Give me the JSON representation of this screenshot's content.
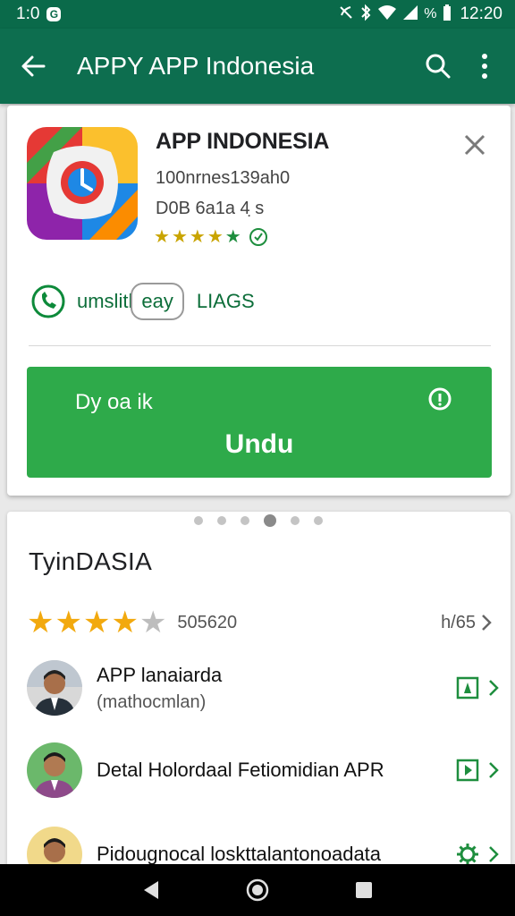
{
  "status_bar": {
    "time_left": "1:0",
    "time_right": "12:20",
    "icons": [
      "notification-badge",
      "mute-icon",
      "bluetooth-icon",
      "wifi-icon",
      "signal-icon",
      "battery-icon"
    ],
    "percent_glyph": "%"
  },
  "app_bar": {
    "title": "APPY APP Indonesia",
    "back_icon": "arrow-left-icon",
    "search_icon": "search-icon",
    "menu_icon": "more-vert-icon"
  },
  "app_card": {
    "name": "APP INDONESIA",
    "meta1": "100nrnes139ah0",
    "meta2": "D0B 6a1a 4 ̣s",
    "stars": 5,
    "feature_text1": "umslitl",
    "feature_pill": "eay",
    "feature_text2": "LIAGS",
    "install_sub": "Dy oa ik",
    "install_label": "Undu"
  },
  "pager": {
    "count": 6,
    "active": 3
  },
  "reviews_section": {
    "title": "TyinDASIA",
    "rating_stars_filled": 4,
    "rating_count": "505620",
    "rating_right": "h/65",
    "items": [
      {
        "title": "APP lanaiarda",
        "subtitle": "(mathocmlan)"
      },
      {
        "title": "Detal Holordaal Fetiomidian APR",
        "subtitle": ""
      },
      {
        "title": "Pidougnocal loskttalantonoadata",
        "subtitle": ""
      }
    ]
  },
  "colors": {
    "status_bar": "#0a6a4a",
    "app_bar": "#0d6e4f",
    "install_button": "#2eaa4a",
    "accent_green": "#0d6e3a",
    "star": "#f2a90e"
  },
  "nav_bar": {
    "icons": [
      "back-triangle-icon",
      "home-circle-icon",
      "recents-square-icon"
    ]
  }
}
